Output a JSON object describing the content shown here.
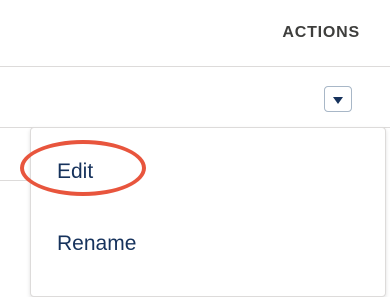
{
  "table": {
    "actions_header": "ACTIONS",
    "row_action_icon": "chevron-down-icon"
  },
  "menu": {
    "items": [
      {
        "label": "Edit"
      },
      {
        "label": "Rename"
      }
    ]
  },
  "colors": {
    "menu_text": "#16325c",
    "header_text": "#3e3e3c",
    "border": "#dddbda",
    "highlight": "#e8553d"
  }
}
